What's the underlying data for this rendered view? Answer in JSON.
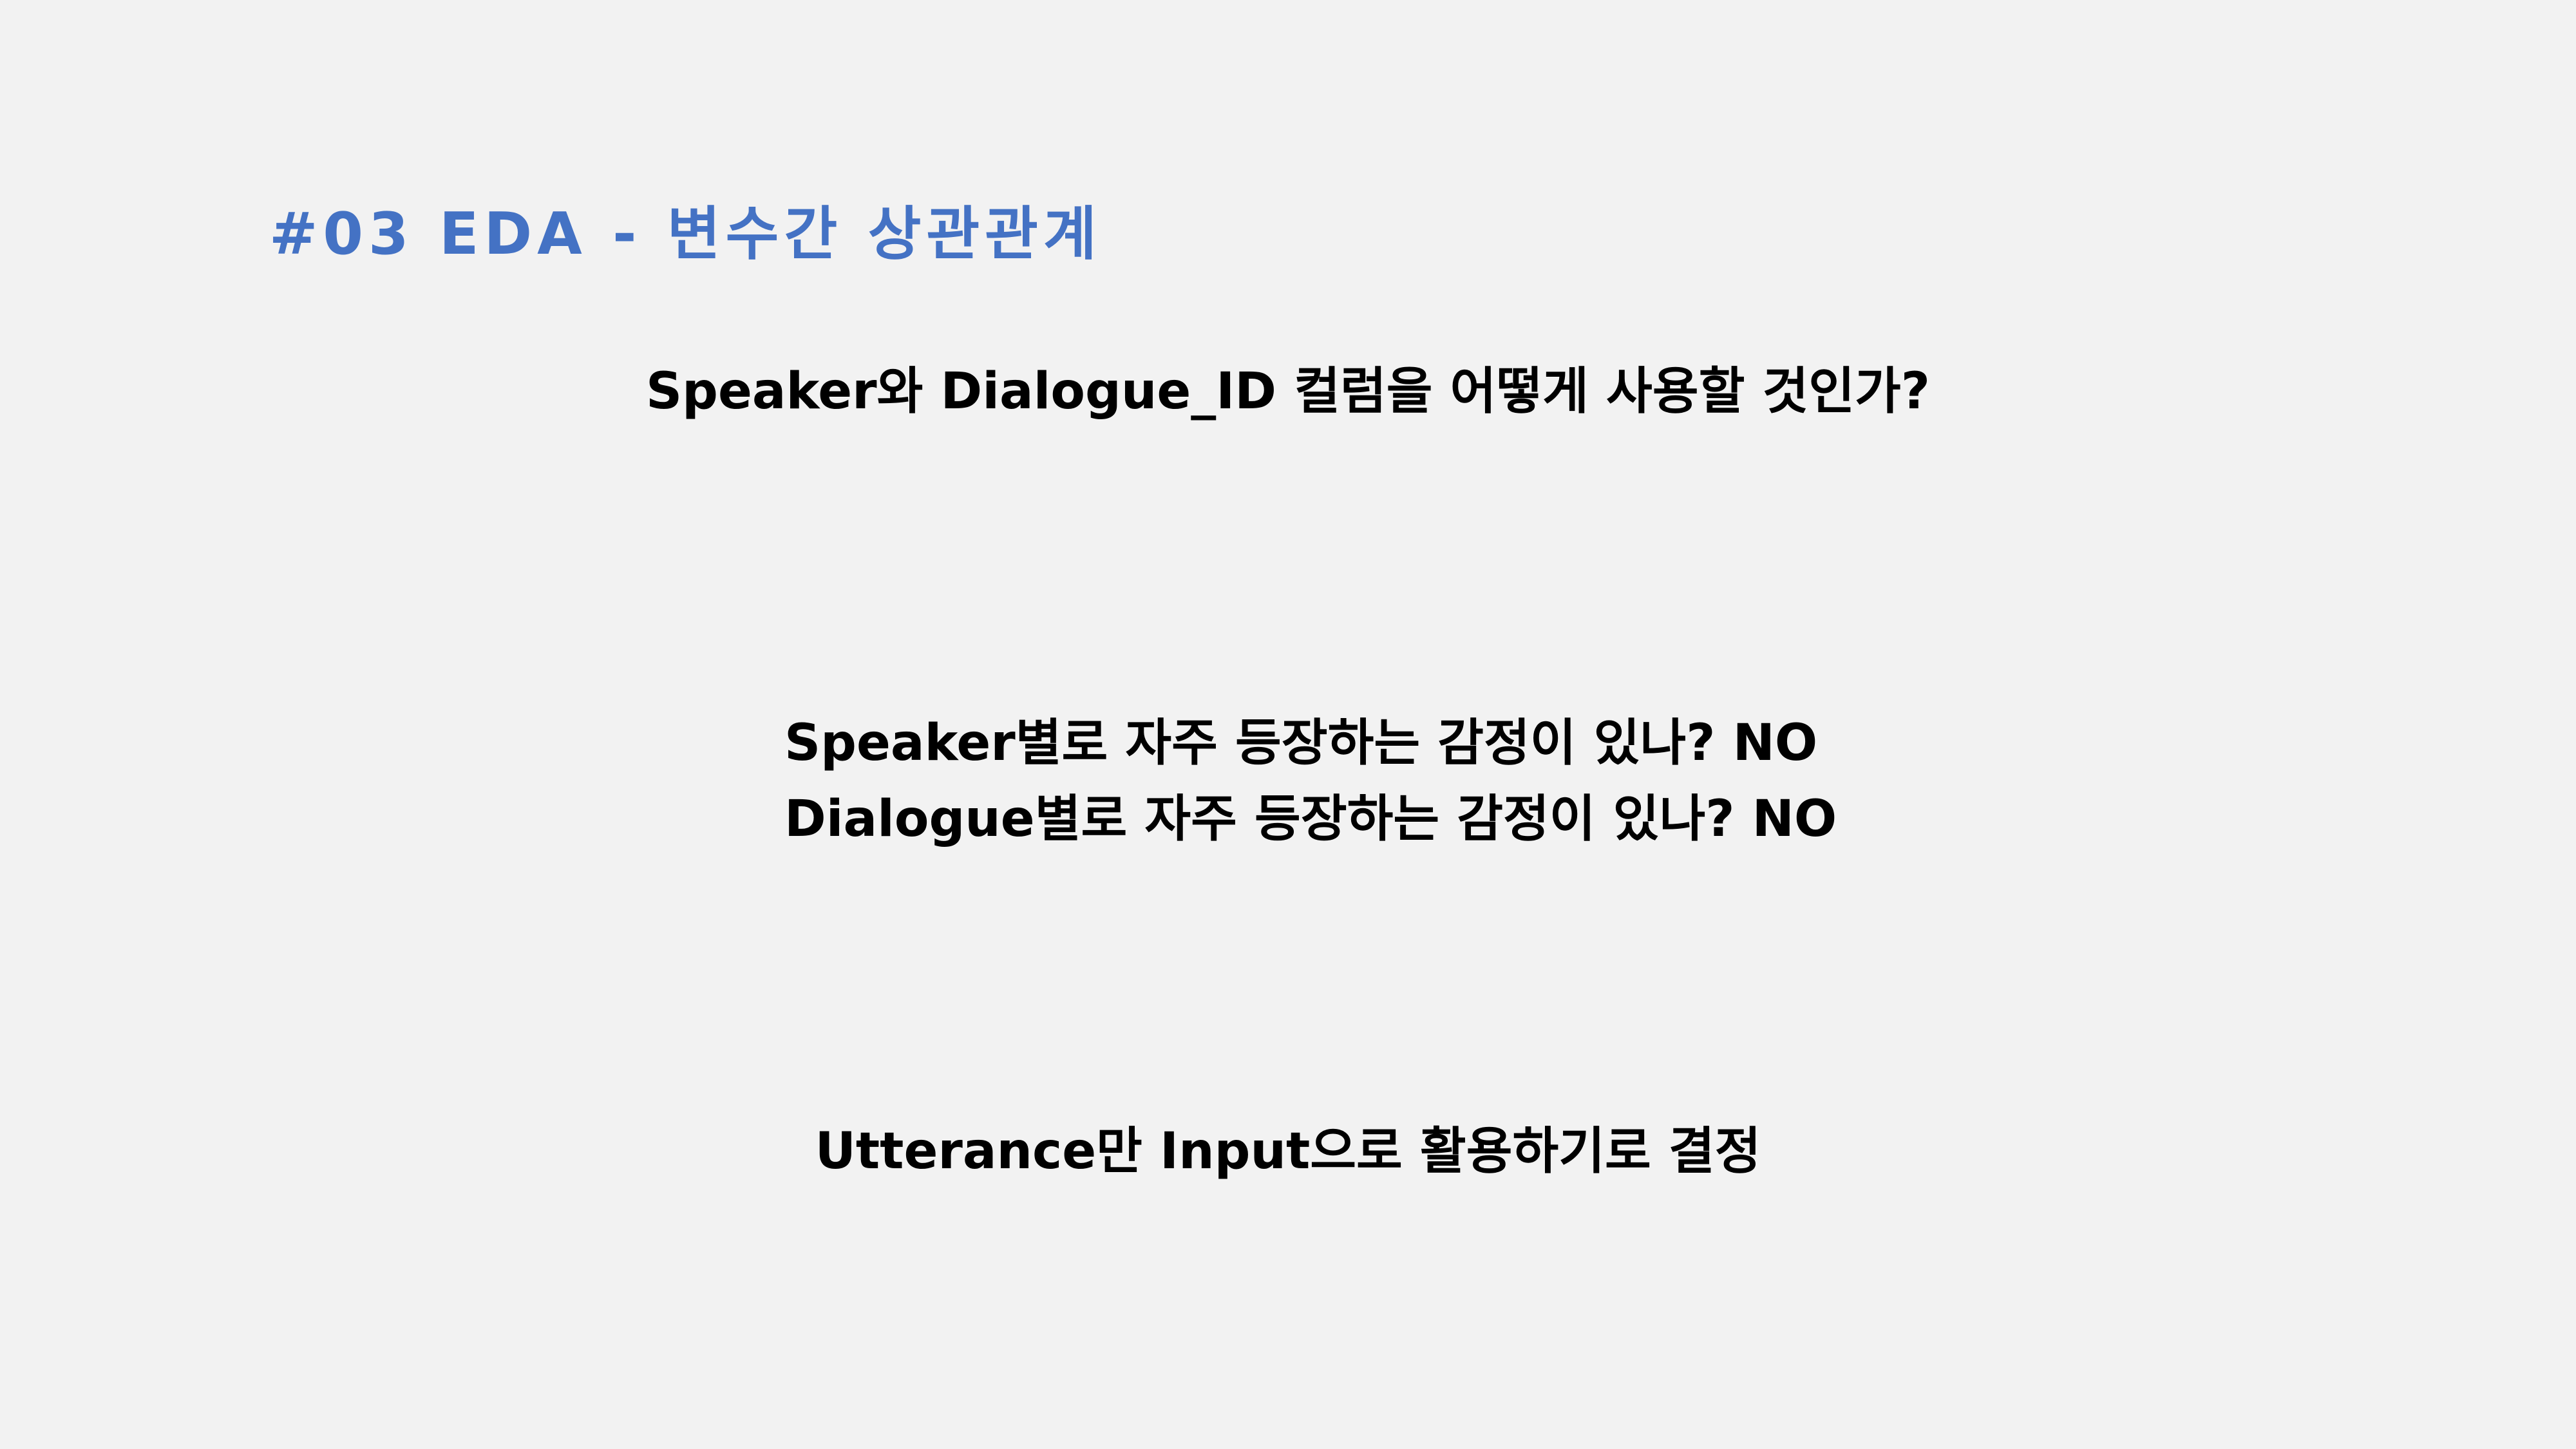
{
  "slide": {
    "title": "#03 EDA - 변수간 상관관계",
    "question": "Speaker와 Dialogue_ID 컬럼을 어떻게 사용할 것인가?",
    "findings": [
      "Speaker별로 자주 등장하는 감정이 있나? NO",
      "Dialogue별로 자주 등장하는 감정이 있나? NO"
    ],
    "conclusion": "Utterance만 Input으로 활용하기로 결정",
    "accent_color": "#4472c4",
    "background_color": "#f2f2f2"
  }
}
